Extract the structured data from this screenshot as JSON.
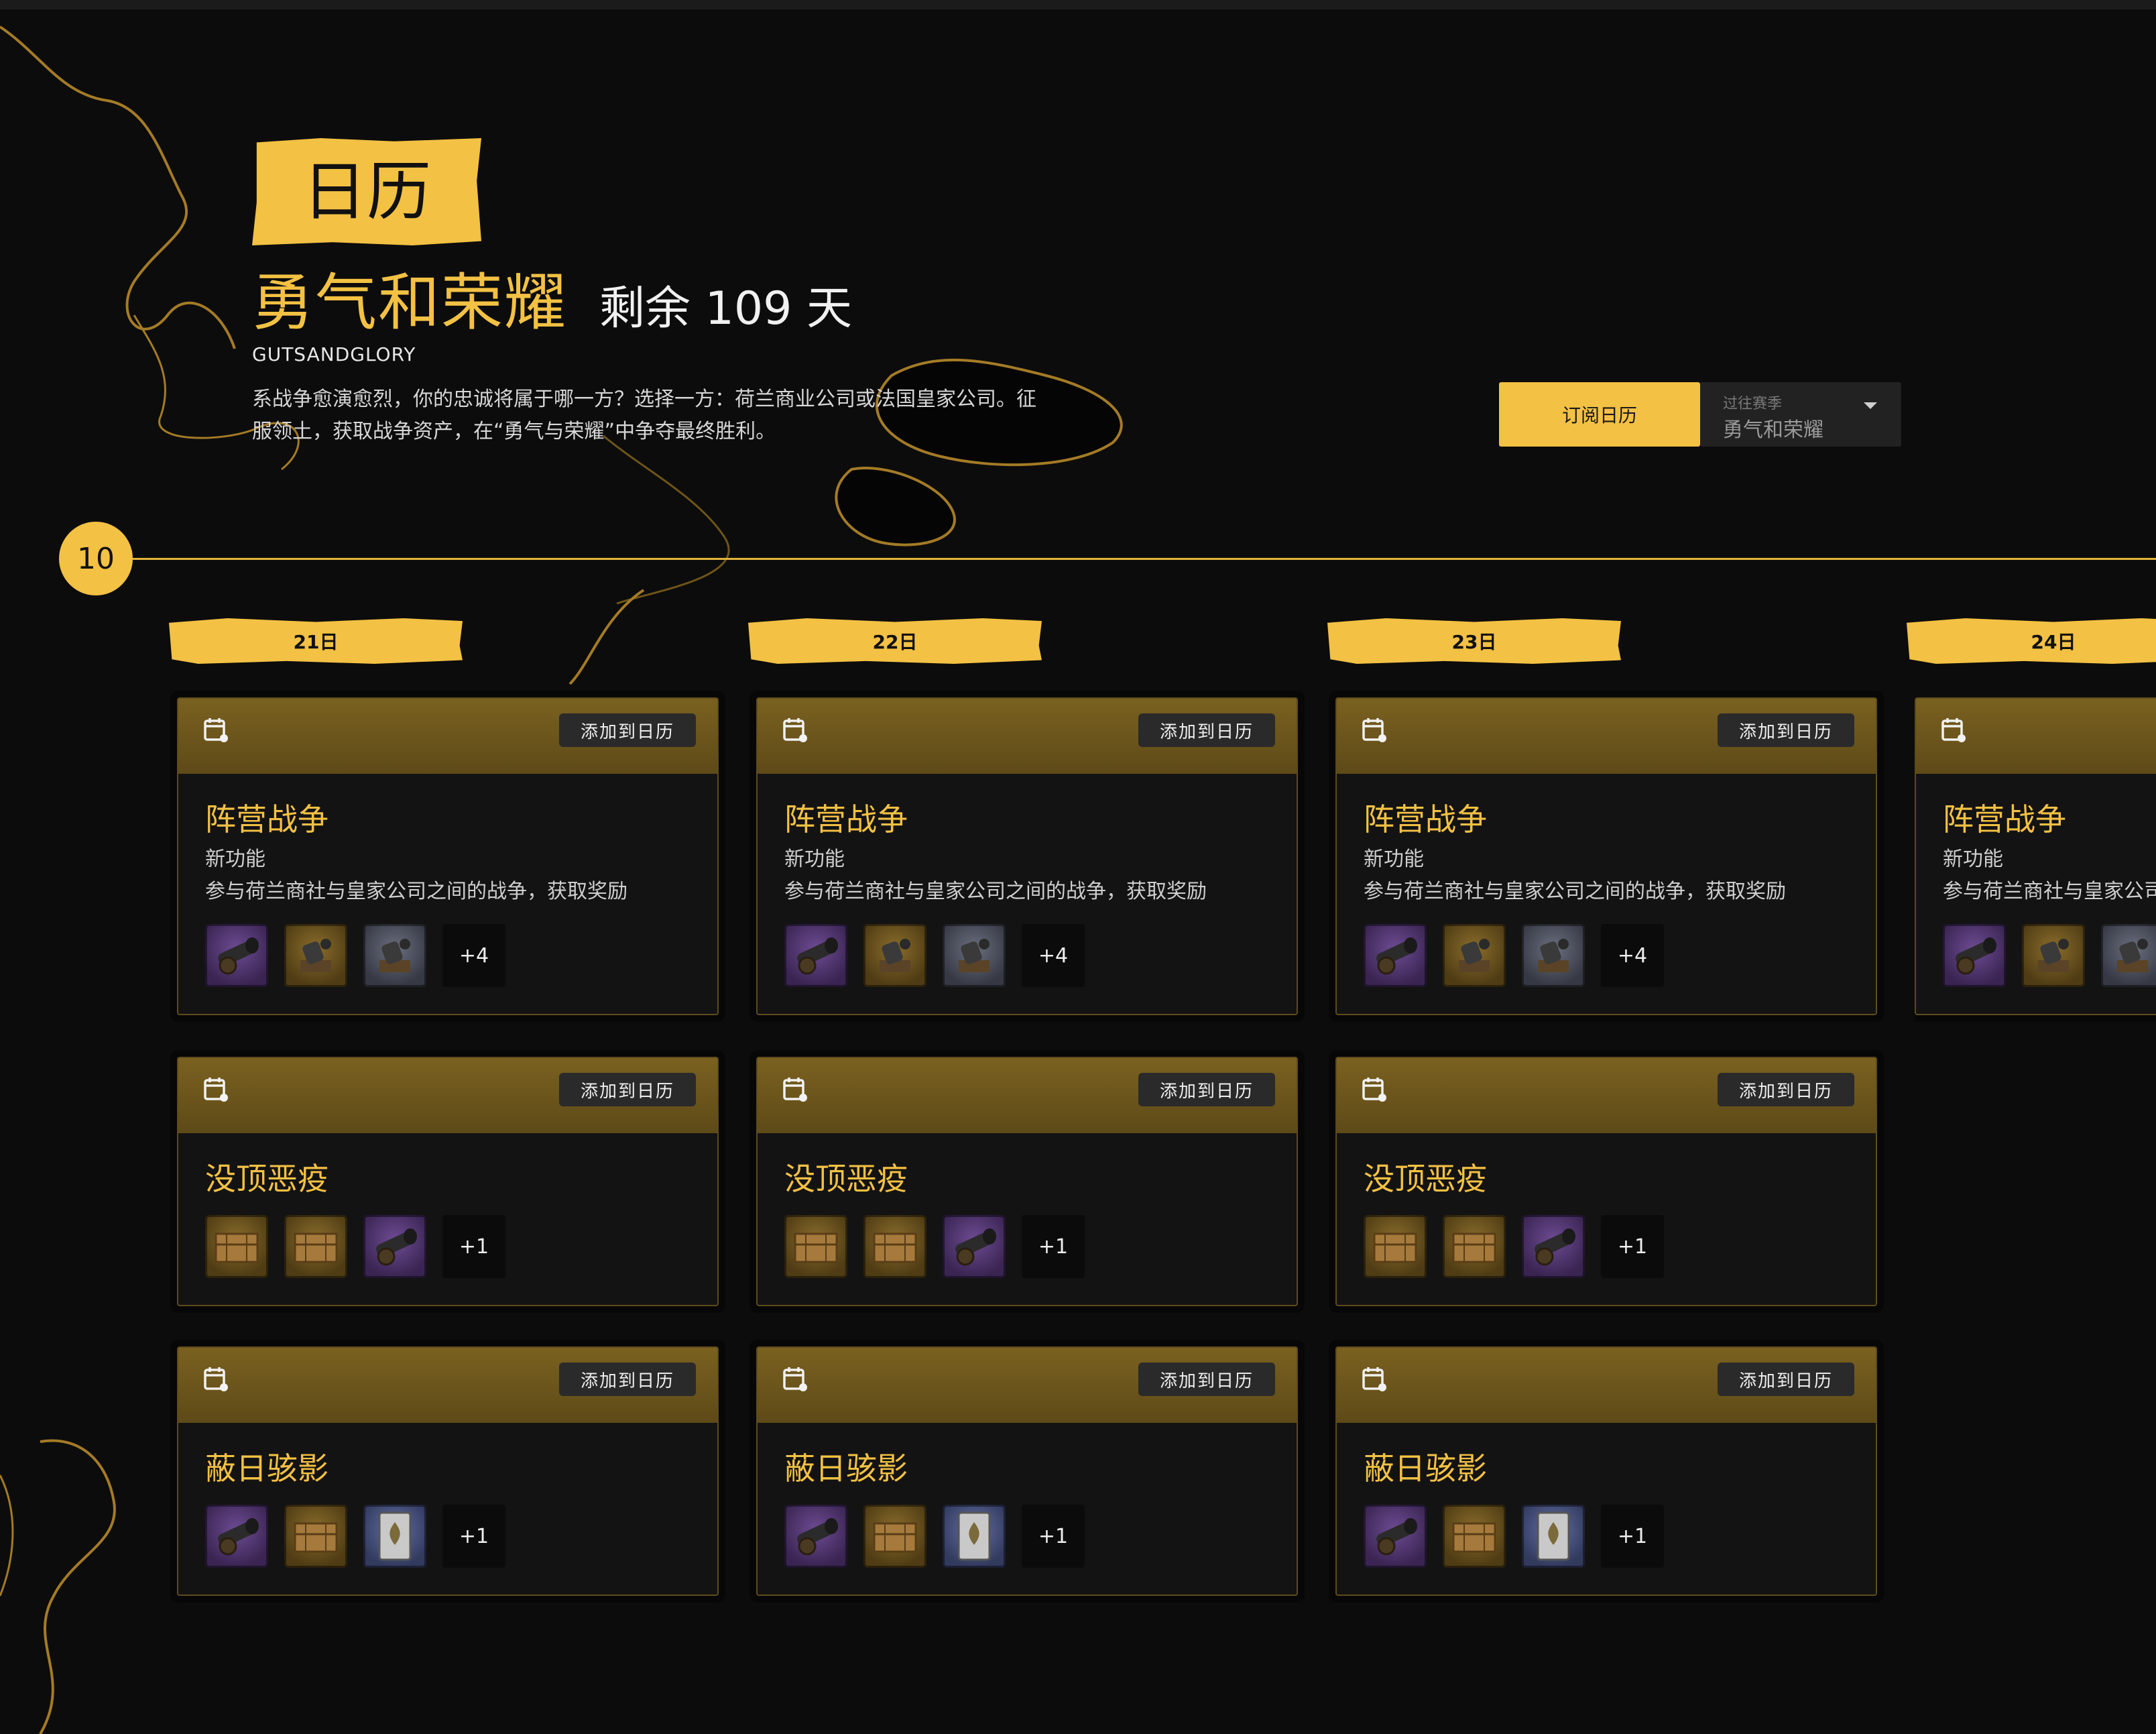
{
  "header": {
    "calendar_tag": "日历",
    "season_name": "勇气和荣耀",
    "days_left": "剩余 109 天",
    "season_code": "GUTSANDGLORY",
    "description": "系战争愈演愈烈，你的忠诚将属于哪一方？选择一方：荷兰商业公司或法国皇家公司。征服领土，获取战争资产，在“勇气与荣耀”中争夺最终胜利。"
  },
  "controls": {
    "subscribe_label": "订阅日历",
    "season_select_label": "过往赛季",
    "season_select_value": "勇气和荣耀"
  },
  "month": "10",
  "days": [
    {
      "label": "21日"
    },
    {
      "label": "22日"
    },
    {
      "label": "23日"
    },
    {
      "label": "24日"
    }
  ],
  "add_label": "添加到日历",
  "events": [
    {
      "title": "阵营战争",
      "subtitle": "新功能",
      "description": "参与荷兰商社与皇家公司之间的战争，获取奖励",
      "rewards": [
        "cannon-purple-icon",
        "mortar-gold-icon",
        "cannon-gray-icon"
      ],
      "more": "+4"
    },
    {
      "title": "没顶恶疫",
      "rewards": [
        "chest-gold-icon",
        "chest-gold-icon",
        "cannon-purple-icon"
      ],
      "more": "+1"
    },
    {
      "title": "蔽日骇影",
      "rewards": [
        "cannon-purple-icon",
        "chest-gold-icon",
        "card-blue-icon"
      ],
      "more": "+1"
    }
  ],
  "colors": {
    "accent": "#f3c143",
    "background": "#0c0c0c",
    "card_header": "#6b5520",
    "card_body": "#141313"
  }
}
